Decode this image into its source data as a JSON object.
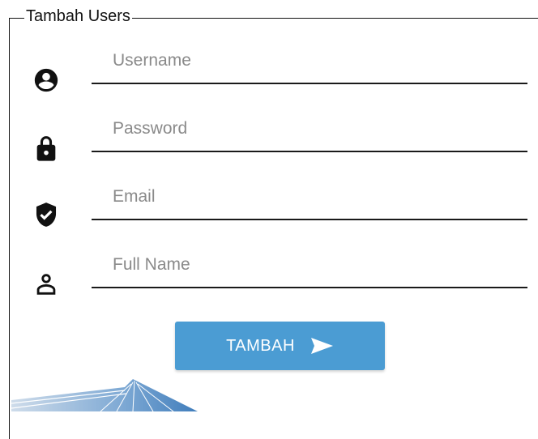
{
  "form": {
    "legend": "Tambah Users",
    "fields": [
      {
        "placeholder": "Username",
        "value": "",
        "icon": "user-circle-icon"
      },
      {
        "placeholder": "Password",
        "value": "",
        "icon": "lock-icon"
      },
      {
        "placeholder": "Email",
        "value": "",
        "icon": "shield-check-icon"
      },
      {
        "placeholder": "Full Name",
        "value": "",
        "icon": "user-outline-icon"
      }
    ],
    "submit_label": "TAMBAH",
    "submit_icon": "send-arrow-icon"
  },
  "colors": {
    "accent": "#4b9cd3",
    "text": "#111111",
    "placeholder": "#8a8a8a"
  }
}
